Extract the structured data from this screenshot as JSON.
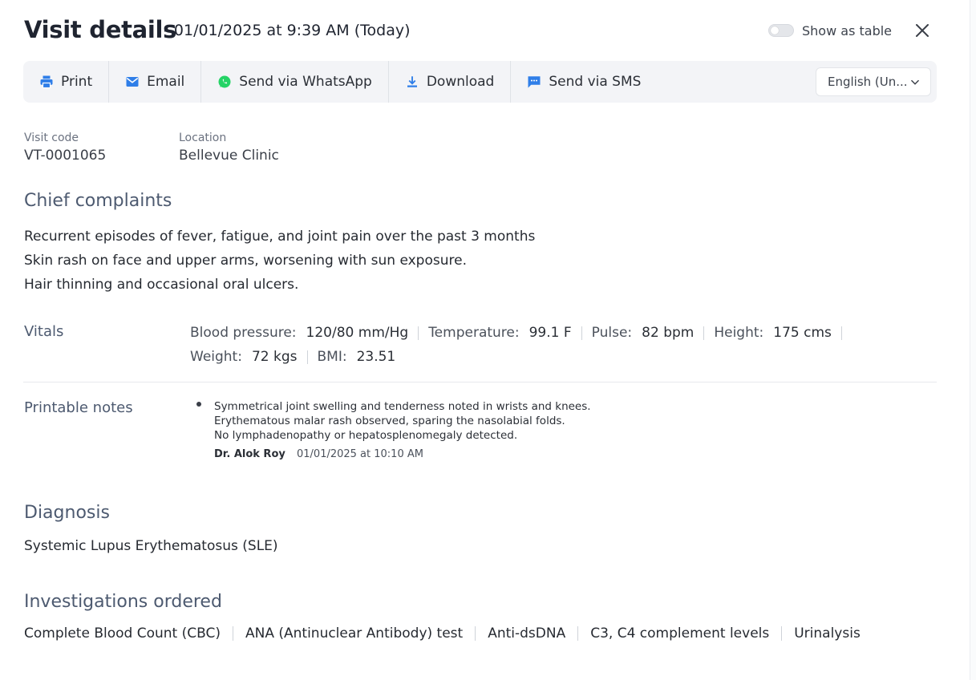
{
  "header": {
    "title": "Visit details",
    "subtitle": "- 01/01/2025 at 9:39 AM (Today)",
    "toggle_label": "Show as table",
    "toggle_on": false
  },
  "toolbar": {
    "print_label": "Print",
    "email_label": "Email",
    "whatsapp_label": "Send via WhatsApp",
    "download_label": "Download",
    "sms_label": "Send via SMS",
    "language_value": "English (Un...",
    "icons": [
      "printer-icon",
      "mail-icon",
      "whatsapp-icon",
      "download-icon",
      "sms-icon",
      "chevron-down-icon"
    ],
    "accent_color": "#2f7ee8",
    "whatsapp_color": "#25d366"
  },
  "meta": {
    "visit_code_label": "Visit code",
    "visit_code_value": "VT-0001065",
    "location_label": "Location",
    "location_value": "Bellevue Clinic"
  },
  "chief_complaints": {
    "title": "Chief complaints",
    "items": [
      "Recurrent episodes of fever, fatigue, and joint pain over the past 3 months",
      "Skin rash on face and upper arms, worsening with sun exposure.",
      "Hair thinning and occasional oral ulcers."
    ]
  },
  "vitals": {
    "title": "Vitals",
    "items": [
      {
        "label": "Blood pressure:",
        "value": "120/80 mm/Hg"
      },
      {
        "label": "Temperature:",
        "value": "99.1 F"
      },
      {
        "label": "Pulse:",
        "value": "82 bpm"
      },
      {
        "label": "Height:",
        "value": "175 cms"
      },
      {
        "label": "Weight:",
        "value": "72 kgs"
      },
      {
        "label": "BMI:",
        "value": "23.51"
      }
    ]
  },
  "printable_notes": {
    "title": "Printable notes",
    "lines": [
      "Symmetrical joint swelling and tenderness noted in wrists and knees.",
      "Erythematous malar rash observed, sparing the nasolabial folds.",
      "No lymphadenopathy or hepatosplenomegaly detected."
    ],
    "author": "Dr. Alok Roy",
    "timestamp": "01/01/2025 at 10:10 AM"
  },
  "diagnosis": {
    "title": "Diagnosis",
    "value": "Systemic Lupus Erythematosus (SLE)"
  },
  "investigations": {
    "title": "Investigations ordered",
    "items": [
      "Complete Blood Count (CBC)",
      "ANA (Antinuclear Antibody) test",
      "Anti-dsDNA",
      "C3, C4 complement levels",
      "Urinalysis"
    ]
  }
}
